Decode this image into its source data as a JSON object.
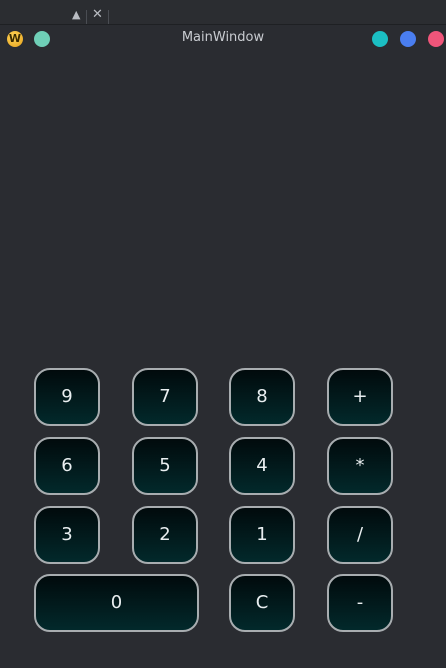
{
  "window": {
    "title": "MainWindow",
    "app_icon_letter": "W"
  },
  "colors": {
    "dot_teal_left": "#6fcfb7",
    "dot_cyan": "#1bbfc3",
    "dot_blue": "#4a7ef0",
    "dot_pink": "#f0557a"
  },
  "keys": {
    "k9": "9",
    "k7": "7",
    "k8": "8",
    "plus": "+",
    "k6": "6",
    "k5": "5",
    "k4": "4",
    "multiply": "*",
    "k3": "3",
    "k2": "2",
    "k1": "1",
    "divide": "/",
    "k0": "0",
    "clear": "C",
    "minus": "-"
  }
}
